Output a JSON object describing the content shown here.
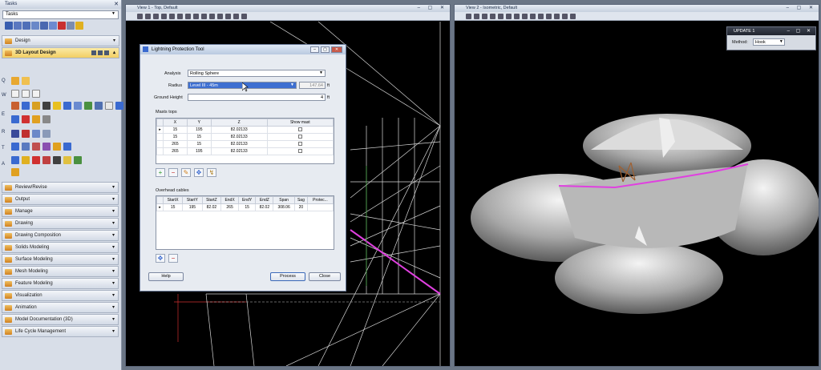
{
  "tasks_panel": {
    "title": "Tasks",
    "combo_value": "Tasks",
    "active_section": "3D Layout Design",
    "top_section": "Design",
    "letters": [
      "Q",
      "W",
      "E",
      "R",
      "T",
      "A"
    ],
    "sections": [
      "Review/Revise",
      "Output",
      "Manage",
      "Drawing",
      "Drawing Composition",
      "Solids Modeling",
      "Surface Modeling",
      "Mesh Modeling",
      "Feature Modeling",
      "Visualization",
      "Animation",
      "Model Documentation (3D)",
      "Life Cycle Management"
    ]
  },
  "view1": {
    "title": "View 1 - Top, Default"
  },
  "view2": {
    "title": "View 2 - Isometric, Default"
  },
  "dialog": {
    "title": "Lightning Protection Tool",
    "analysis_label": "Analysis",
    "analysis_value": "Rolling Sphere",
    "radius_label": "Radius",
    "radius_value": "Level III - 45m",
    "radius_num": "147.64",
    "unit": "ft",
    "ground_label": "Ground Height",
    "ground_value": "4",
    "masts_label": "Masts tops",
    "masts_headers": [
      "X",
      "Y",
      "Z",
      "Show mast"
    ],
    "masts_rows": [
      {
        "x": "15",
        "y": "195",
        "z": "82.02133"
      },
      {
        "x": "15",
        "y": "15",
        "z": "82.02133"
      },
      {
        "x": "265",
        "y": "15",
        "z": "82.02133"
      },
      {
        "x": "265",
        "y": "195",
        "z": "82.02133"
      }
    ],
    "cables_label": "Overhead cables",
    "cables_headers": [
      "StartX",
      "StartY",
      "StartZ",
      "EndX",
      "EndY",
      "EndZ",
      "Span",
      "Sag",
      "Protec..."
    ],
    "cables_rows": [
      [
        "15",
        "195",
        "82.02",
        "265",
        "15",
        "82.02",
        "308.06",
        "20",
        ""
      ]
    ],
    "help_button": "Help",
    "process_button": "Process",
    "close_button": "Close"
  },
  "update_window": {
    "title": "UPDATE 1",
    "method_label": "Method:",
    "method_value": "Hook"
  }
}
